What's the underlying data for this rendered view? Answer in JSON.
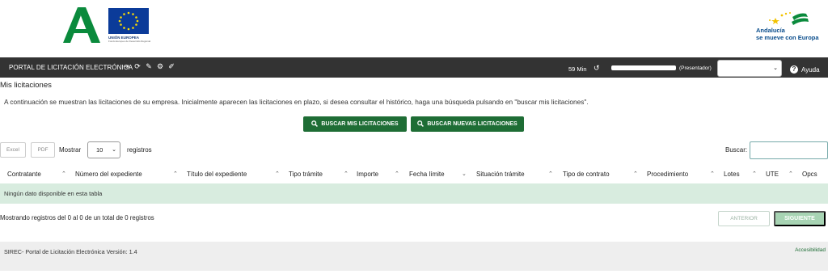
{
  "header": {
    "logos": {
      "andalucia": "junta-andalucia-logo",
      "eu_caption": "UNIÓN EUROPEA",
      "eu_subcaption": "Fondo Europeo de Desarrollo Regional",
      "europa_line1": "Andalucía",
      "europa_line2": "se mueve con Europa"
    }
  },
  "navbar": {
    "title": "PORTAL DE LICITACIÓN ELECTRÓNICA",
    "icons": [
      "logout-icon",
      "refresh-icon",
      "edit-icon",
      "user-settings-icon",
      "user-edit-icon"
    ],
    "timer": "59 Min",
    "role": "(Presentador)",
    "help": "Ayuda"
  },
  "main": {
    "title": "Mis licitaciones",
    "intro": "A continuación se muestran las licitaciones de su empresa. Inicialmente aparecen las licitaciones en plazo, si desea consultar el histórico, haga una búsqueda pulsando en \"buscar mis licitaciones\".",
    "btn_buscar_mis": "BUSCAR MIS LICITACIONES",
    "btn_buscar_nuevas": "BUSCAR NUEVAS LICITACIONES"
  },
  "table_controls": {
    "excel": "Excel",
    "pdf": "PDF",
    "mostrar": "Mostrar",
    "page_length": "10",
    "registros": "registros",
    "buscar": "Buscar:"
  },
  "table": {
    "columns": [
      "Contratante",
      "Número del expediente",
      "Título del expediente",
      "Tipo trámite",
      "Importe",
      "Fecha límite",
      "Situación trámite",
      "Tipo de contrato",
      "Procedimiento",
      "Lotes",
      "UTE",
      "Opcs"
    ],
    "empty": "Ningún dato disponible en esta tabla",
    "info": "Mostrando registros del 0 al 0 de un total de 0 registros",
    "prev": "ANTERIOR",
    "next": "SIGUIENTE"
  },
  "footer": {
    "version": "SIREC- Portal de Licitación Electrónica Versión: 1.4",
    "accesibilidad": "Accesibilidad"
  },
  "colors": {
    "brand_green": "#1e6d35",
    "navbar_bg": "#333333",
    "empty_row_bg": "#d8ecdf"
  }
}
